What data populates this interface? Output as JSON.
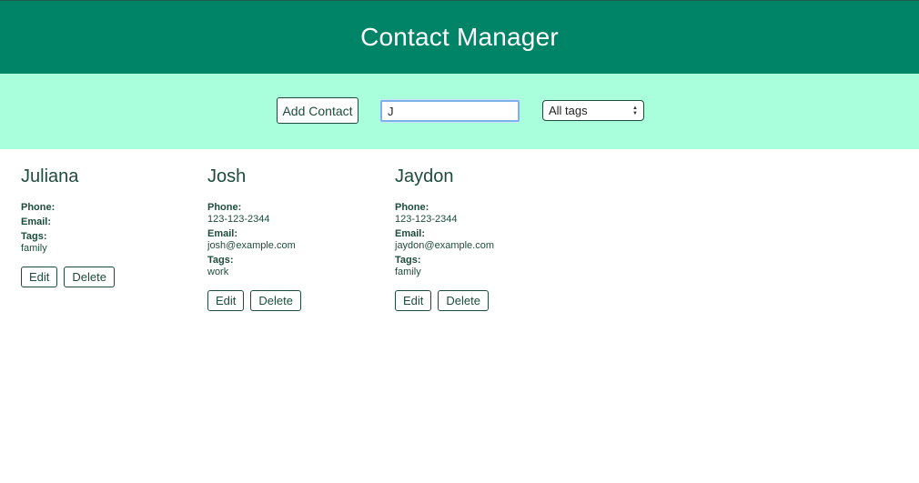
{
  "header": {
    "title": "Contact Manager"
  },
  "toolbar": {
    "add_label": "Add Contact",
    "search_value": "J",
    "tag_filter": "All tags"
  },
  "contacts": [
    {
      "name": "Juliana",
      "phone_label": "Phone:",
      "phone": "",
      "email_label": "Email:",
      "email": "",
      "tags_label": "Tags:",
      "tags": "family",
      "edit_label": "Edit",
      "delete_label": "Delete"
    },
    {
      "name": "Josh",
      "phone_label": "Phone:",
      "phone": "123-123-2344",
      "email_label": "Email:",
      "email": "josh@example.com",
      "tags_label": "Tags:",
      "tags": "work",
      "edit_label": "Edit",
      "delete_label": "Delete"
    },
    {
      "name": "Jaydon",
      "phone_label": "Phone:",
      "phone": "123-123-2344",
      "email_label": "Email:",
      "email": "jaydon@example.com",
      "tags_label": "Tags:",
      "tags": "family",
      "edit_label": "Edit",
      "delete_label": "Delete"
    }
  ],
  "colors": {
    "header_bg": "#008467",
    "toolbar_bg": "#a9fedc",
    "text": "#1d4c3c"
  }
}
